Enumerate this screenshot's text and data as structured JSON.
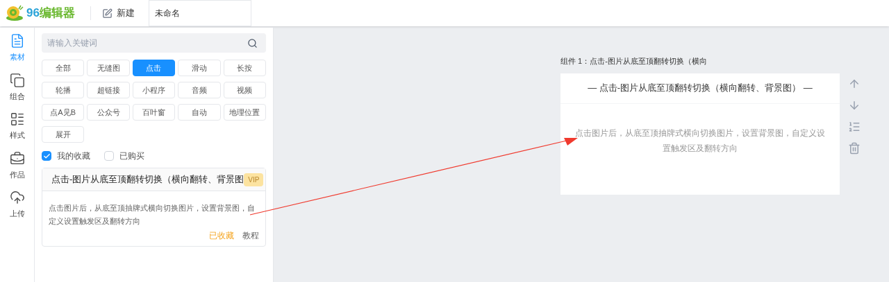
{
  "header": {
    "logo_digits": "96",
    "logo_text": "编辑器",
    "new_button": "新建",
    "title_value": "未命名"
  },
  "nav": [
    {
      "label": "素材",
      "selected": true
    },
    {
      "label": "组合",
      "selected": false
    },
    {
      "label": "样式",
      "selected": false
    },
    {
      "label": "作品",
      "selected": false
    },
    {
      "label": "上传",
      "selected": false
    }
  ],
  "search": {
    "placeholder": "请输入关键词"
  },
  "tags": [
    {
      "label": "全部",
      "selected": false
    },
    {
      "label": "无缝图",
      "selected": false
    },
    {
      "label": "点击",
      "selected": true
    },
    {
      "label": "滑动",
      "selected": false
    },
    {
      "label": "长按",
      "selected": false
    },
    {
      "label": "轮播",
      "selected": false
    },
    {
      "label": "超链接",
      "selected": false
    },
    {
      "label": "小程序",
      "selected": false
    },
    {
      "label": "音频",
      "selected": false
    },
    {
      "label": "视频",
      "selected": false
    },
    {
      "label": "点A见B",
      "selected": false
    },
    {
      "label": "公众号",
      "selected": false
    },
    {
      "label": "百叶窗",
      "selected": false
    },
    {
      "label": "自动",
      "selected": false
    },
    {
      "label": "地理位置",
      "selected": false
    },
    {
      "label": "展开",
      "selected": false
    }
  ],
  "filters": [
    {
      "label": "我的收藏",
      "checked": true
    },
    {
      "label": "已购买",
      "checked": false
    }
  ],
  "card": {
    "title": "点击-图片从底至顶翻转切换（横向翻转、背景图",
    "badge": "VIP",
    "description": "点击图片后，从底至顶抽牌式横向切换图片，设置背景图，自定义设置触发区及翻转方向",
    "favorite": "已收藏",
    "tutorial": "教程"
  },
  "preview": {
    "label": "组件 1：点击-图片从底至顶翻转切换（横向",
    "title": "— 点击-图片从底至顶翻转切换（横向翻转、背景图） —",
    "description": "点击图片后，从底至顶抽牌式横向切换图片，设置背景图，自定义设置触发区及翻转方向"
  }
}
